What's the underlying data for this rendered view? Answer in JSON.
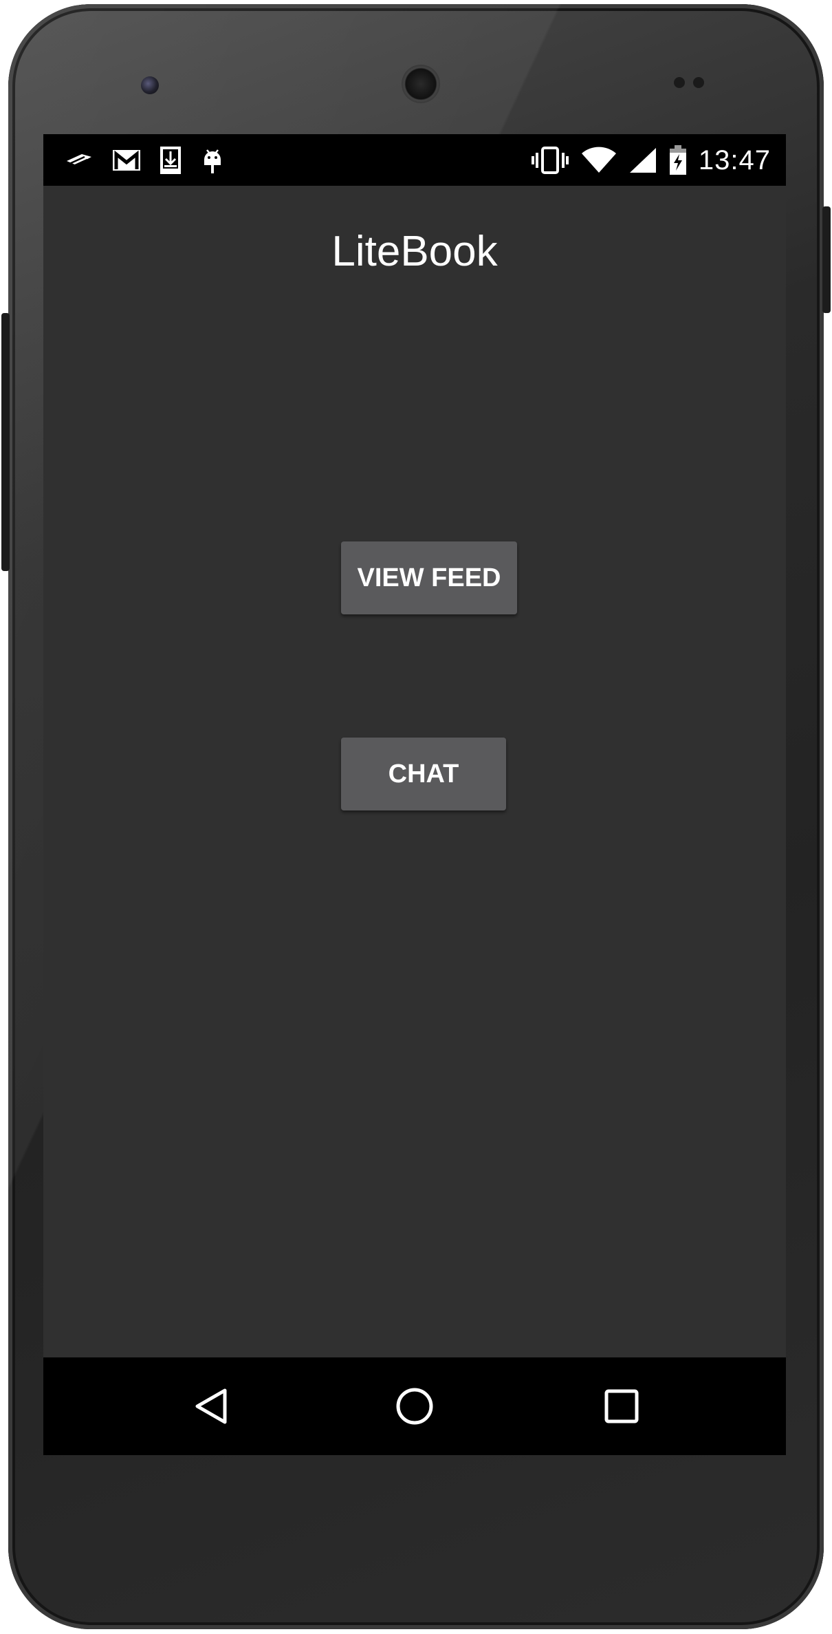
{
  "status_bar": {
    "time": "13:47",
    "left_icons": [
      "bank-notification-icon",
      "gmail-icon",
      "download-icon",
      "android-debug-icon"
    ],
    "right_icons": [
      "vibrate-icon",
      "wifi-icon",
      "signal-icon",
      "battery-charging-icon"
    ]
  },
  "app": {
    "title": "LiteBook",
    "buttons": {
      "view_feed": "VIEW FEED",
      "chat": "CHAT"
    }
  },
  "nav_bar": {
    "icons": [
      "back-icon",
      "home-icon",
      "recents-icon"
    ]
  },
  "colors": {
    "background": "#303030",
    "button": "#5a5a5c",
    "text": "#ffffff",
    "bars": "#000000"
  }
}
